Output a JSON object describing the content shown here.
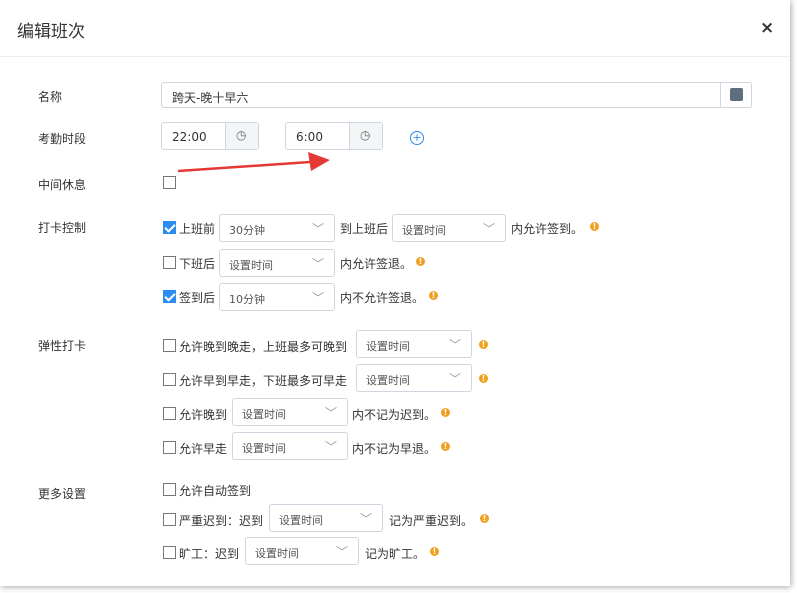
{
  "dialog": {
    "title": "编辑班次",
    "close_label": "×"
  },
  "fields": {
    "name_label": "名称",
    "name_value": "跨天-晚十早六",
    "time_label": "考勤时段",
    "start_time": "22:00",
    "end_time": "6:00",
    "rest_label": "中间休息",
    "punch_label": "打卡控制",
    "flex_label": "弹性打卡",
    "more_label": "更多设置"
  },
  "punch": {
    "before_on": {
      "label": "上班前",
      "value": "30分钟",
      "checked": true,
      "to": "到上班后",
      "after_value": "设置时间",
      "suffix": "内允许签到。"
    },
    "after_off": {
      "label": "下班后",
      "value": "设置时间",
      "checked": false,
      "suffix": "内允许签退。"
    },
    "after_sign": {
      "label": "签到后",
      "value": "10分钟",
      "checked": true,
      "suffix": "内不允许签退。"
    }
  },
  "flex": {
    "late_early": {
      "label": "允许晚到晚走，上班最多可晚到",
      "value": "设置时间"
    },
    "early_early": {
      "label": "允许早到早走，下班最多可早走",
      "value": "设置时间"
    },
    "allow_late": {
      "label": "允许晚到",
      "value": "设置时间",
      "suffix": "内不记为迟到。"
    },
    "allow_early": {
      "label": "允许早走",
      "value": "设置时间",
      "suffix": "内不记为早退。"
    }
  },
  "more": {
    "auto_sign": {
      "label": "允许自动签到"
    },
    "severe_late": {
      "label": "严重迟到：迟到",
      "value": "设置时间",
      "suffix": "记为严重迟到。"
    },
    "absent": {
      "label": "旷工：迟到",
      "value": "设置时间",
      "suffix": "记为旷工。"
    }
  },
  "colors": {
    "accent": "#2d8cf0",
    "warning": "#f0a020",
    "arrow": "#e53935"
  },
  "icons": {
    "clock": "◷",
    "chevron": "﹀",
    "plus": "+",
    "warn": "!"
  }
}
